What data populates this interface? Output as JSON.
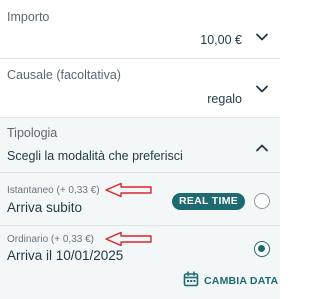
{
  "importo": {
    "label": "Importo",
    "value": "10,00 €",
    "icon": "chevron-down-icon"
  },
  "causale": {
    "label": "Causale (facoltativa)",
    "value": "regalo",
    "icon": "chevron-down-icon"
  },
  "tipologia": {
    "label": "Tipologia",
    "heading": "Scegli la modalità che preferisci",
    "icon": "chevron-up-icon",
    "options": [
      {
        "label": "Istantaneo (+ 0,33 €)",
        "title": "Arriva subito",
        "badge": "REAL TIME",
        "selected": false
      },
      {
        "label": "Ordinario (+ 0,33 €)",
        "title": "Arriva il 10/01/2025",
        "selected": true
      }
    ],
    "cambia_data": {
      "label": "CAMBIA DATA",
      "icon": "calendar-icon"
    }
  },
  "colors": {
    "accent": "#1d6b70",
    "annotation_arrow": "#d9262c",
    "tint_background": "#f3f7f8"
  }
}
